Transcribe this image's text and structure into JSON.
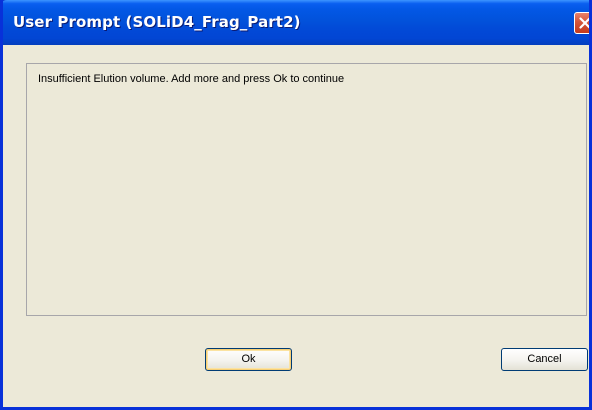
{
  "window": {
    "title": "User Prompt (SOLiD4_Frag_Part2)"
  },
  "dialog": {
    "message": "Insufficient Elution volume. Add more and press Ok to continue"
  },
  "buttons": {
    "ok_label": "Ok",
    "cancel_label": "Cancel"
  },
  "icons": {
    "close": "close-icon"
  },
  "colors": {
    "titlebar": "#0252db",
    "window_border": "#0831d9",
    "client_background": "#ece9d8",
    "close_button": "#d4553a"
  }
}
